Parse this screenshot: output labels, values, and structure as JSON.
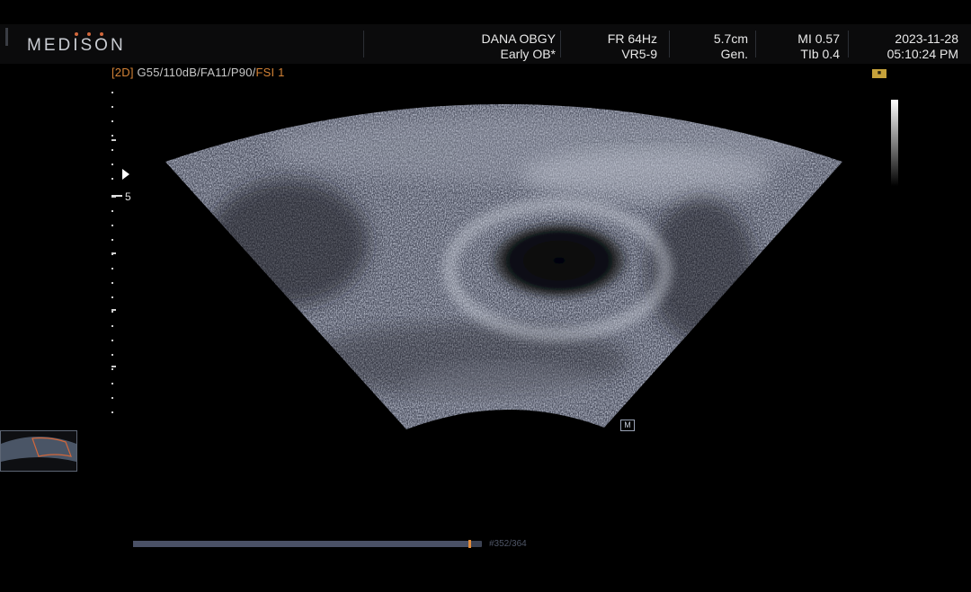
{
  "header": {
    "logo": "MEDISON",
    "hospital": "DANA OBGY",
    "preset": "Early OB*",
    "frame_rate": "FR 64Hz",
    "probe": "VR5-9",
    "depth": "5.7cm",
    "mode": "Gen.",
    "mi": "MI 0.57",
    "tib": "TIb 0.4",
    "date": "2023-11-28",
    "time": "05:10:24 PM"
  },
  "imaging": {
    "mode_tag": "[2D]",
    "params": " G55/110dB/FA11/P90/",
    "fsi": "FSI 1",
    "depth_marker": "5",
    "m_marker": "M"
  },
  "cine": {
    "frame_label": "#352/364",
    "progress": 0.967
  },
  "colors": {
    "accent_orange": "#d38236",
    "background": "#000000"
  },
  "icons": {
    "focus": "triangle-right-focus-icon",
    "badge": "orientation-badge-icon"
  }
}
